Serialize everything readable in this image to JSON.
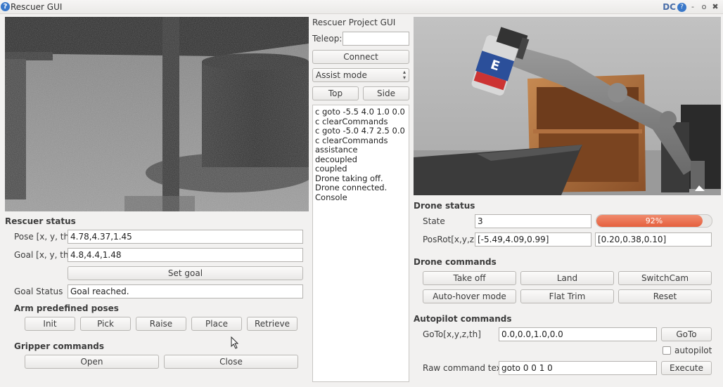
{
  "window": {
    "title": "Rescuer GUI",
    "controls": {
      "minimize": "-",
      "restore": "o",
      "close": "✖",
      "dc": "DC"
    }
  },
  "left": {
    "rescuer_status_header": "Rescuer status",
    "pose_label": "Pose [x, y, th]",
    "pose_value": "4.78,4.37,1.45",
    "goal_label": "Goal [x, y, th]",
    "goal_value": "4.8,4.4,1.48",
    "set_goal_label": "Set goal",
    "goal_status_label": "Goal Status",
    "goal_status_value": "Goal reached.",
    "arm_header": "Arm predefined poses",
    "arm_buttons": [
      "Init",
      "Pick",
      "Raise",
      "Place",
      "Retrieve"
    ],
    "gripper_header": "Gripper commands",
    "gripper_buttons": [
      "Open",
      "Close"
    ]
  },
  "middle": {
    "project_title": "Rescuer Project GUI",
    "teleop_label": "Teleop:",
    "teleop_value": "",
    "connect_label": "Connect",
    "mode_selected": "Assist mode",
    "top_label": "Top",
    "side_label": "Side",
    "console_lines": [
      "c goto -5.5 4.0 1.0 0.0",
      "c clearCommands",
      "c goto -5.0 4.7 2.5 0.0",
      "c clearCommands",
      "assistance",
      "decoupled",
      "coupled",
      "Drone taking off.",
      "Drone connected.",
      "Console"
    ]
  },
  "right": {
    "drone_status_header": "Drone status",
    "state_label": "State",
    "state_value": "3",
    "battery_text": "92%",
    "battery_fraction": 0.92,
    "posrot_label": "PosRot[x,y,z]",
    "pos_value": "[-5.49,4.09,0.99]",
    "rot_value": "[0.20,0.38,0.10]",
    "drone_commands_header": "Drone commands",
    "drone_buttons": [
      "Take off",
      "Land",
      "SwitchCam",
      "Auto-hover mode",
      "Flat Trim",
      "Reset"
    ],
    "autopilot_header": "Autopilot commands",
    "goto_label": "GoTo[x,y,z,th]",
    "goto_value": "0.0,0.0,1.0,0.0",
    "goto_button": "GoTo",
    "autopilot_label": "autopilot",
    "raw_label": "Raw command text:",
    "raw_value": "goto 0 0 1 0",
    "execute_label": "Execute"
  },
  "colors": {
    "battery": "#e5603e",
    "window_bg": "#f2f1f0"
  }
}
